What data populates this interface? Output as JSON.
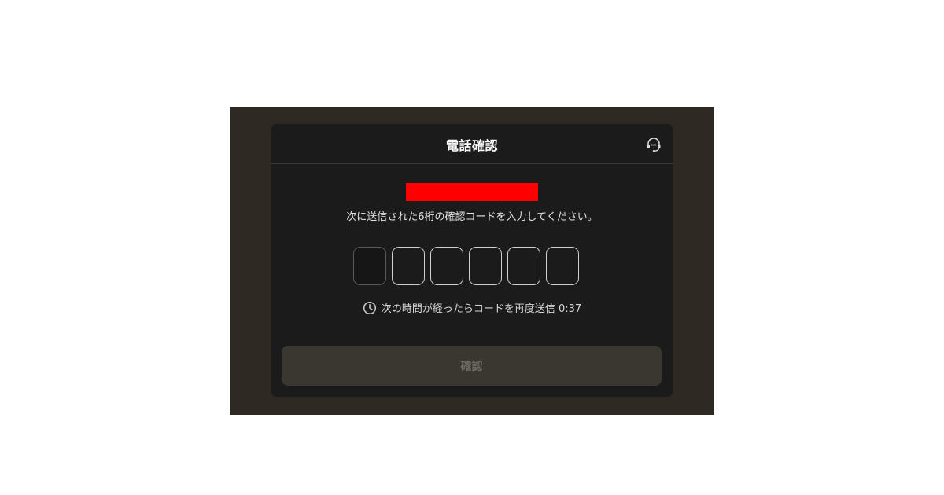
{
  "modal": {
    "title": "電話確認",
    "support_icon": "headset-icon",
    "instruction": "次に送信された6桁の確認コードを入力してください。",
    "otp": {
      "length": 6,
      "values": [
        "",
        "",
        "",
        "",
        "",
        ""
      ]
    },
    "resend": {
      "icon": "clock-icon",
      "text": "次の時間が経ったらコードを再度送信 0:37"
    },
    "confirm_label": "確認"
  },
  "colors": {
    "page_bg": "#ffffff",
    "backdrop": "#2e2a23",
    "modal_bg": "#1b1b1b",
    "redaction": "#ff0000",
    "button_disabled_bg": "#3a3730",
    "button_disabled_text": "#6e6a62"
  }
}
